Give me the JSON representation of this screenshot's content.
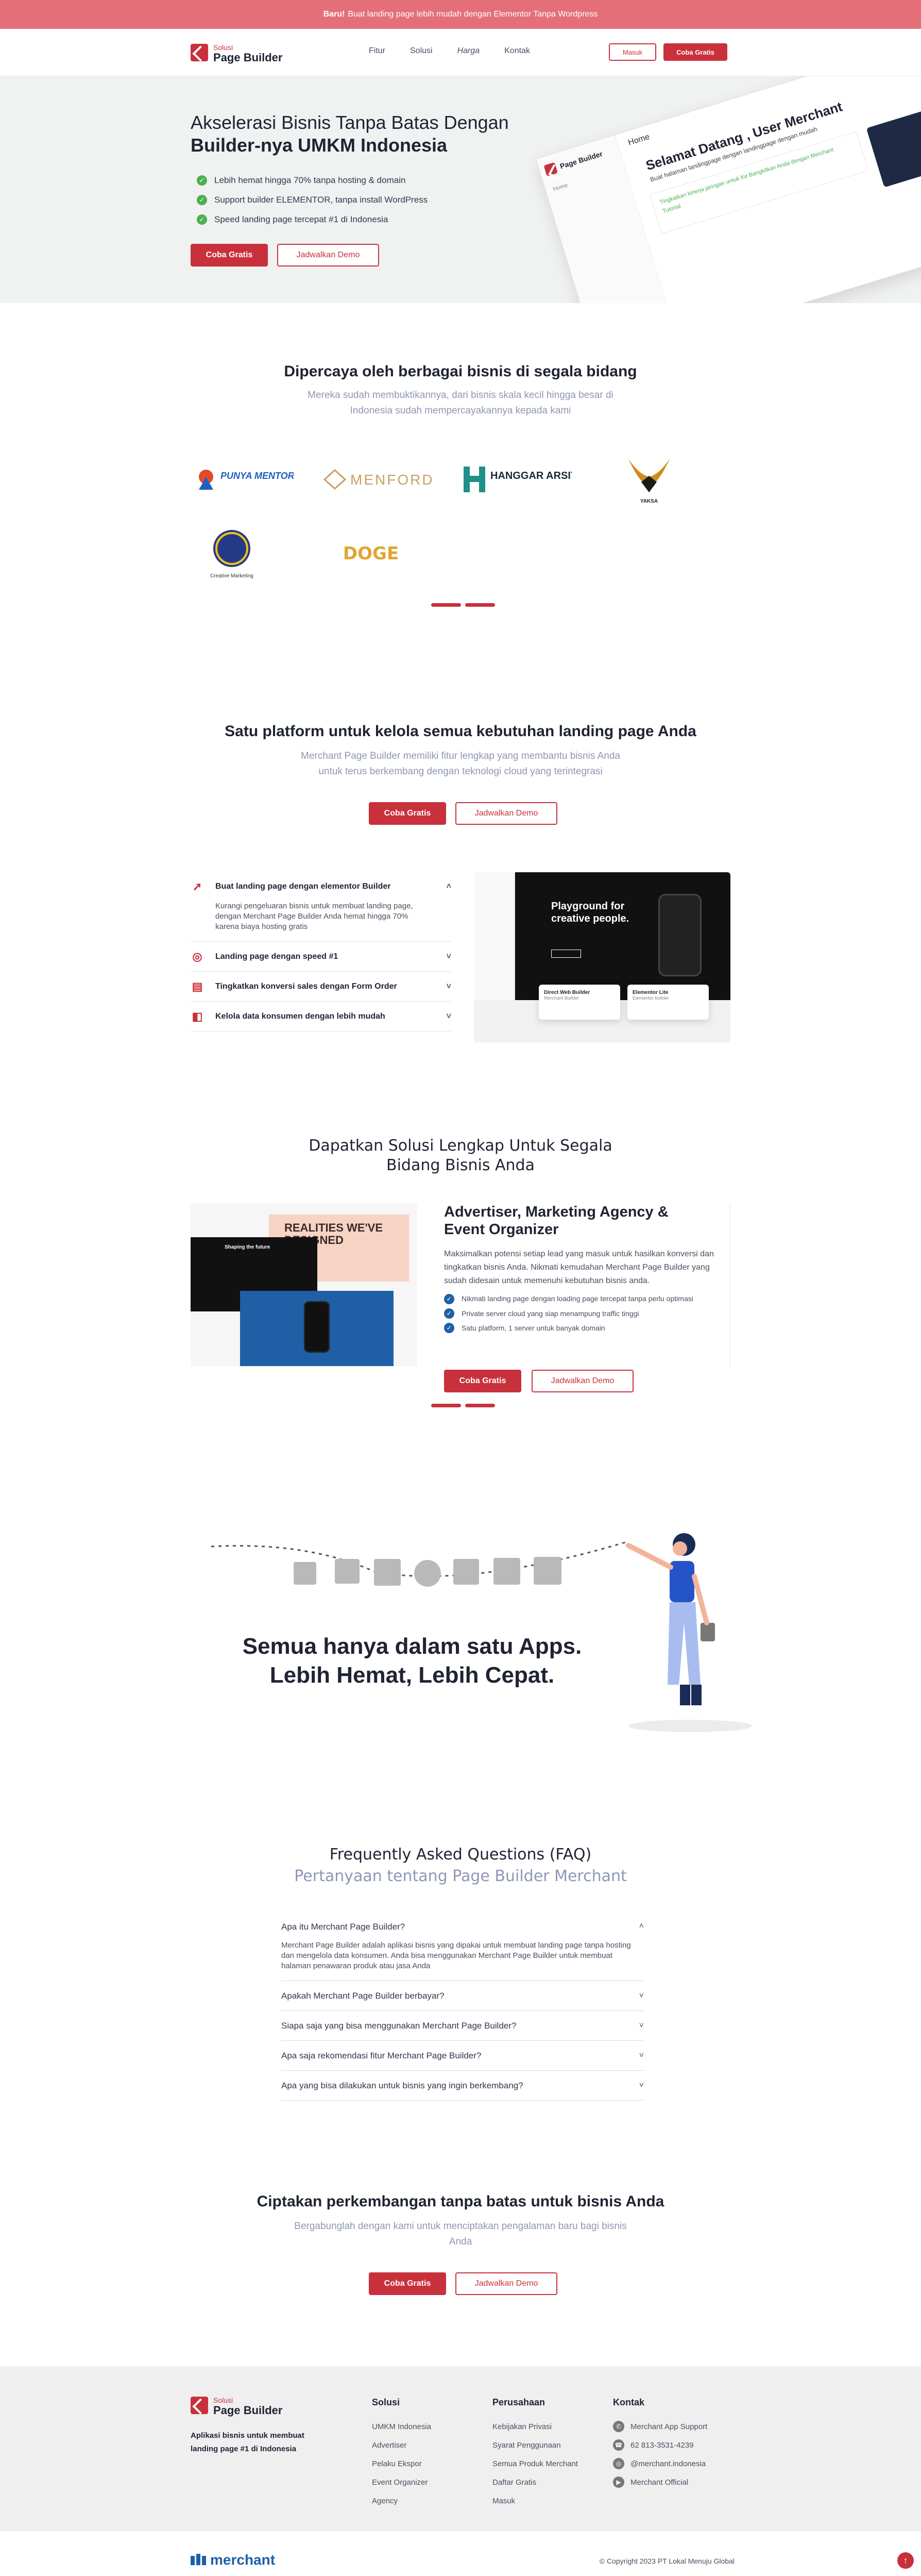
{
  "topbar": {
    "bold": "Baru!",
    "text": "Buat landing page lebih mudah dengan Elementor Tanpa Wordpress"
  },
  "header": {
    "logo_small": "Solusi",
    "logo_big": "Page Builder",
    "nav": [
      "Fitur",
      "Solusi",
      "Harga",
      "Kontak"
    ],
    "login": "Masuk",
    "try": "Coba Gratis"
  },
  "hero": {
    "title_line1": "Akselerasi Bisnis Tanpa Batas Dengan",
    "title_line2": "Builder-nya UMKM Indonesia",
    "bullets": [
      "Lebih hemat hingga 70% tanpa hosting & domain",
      "Support builder ELEMENTOR, tanpa install WordPress",
      "Speed landing page tercepat #1 di Indonesia"
    ],
    "cta_primary": "Coba Gratis",
    "cta_secondary": "Jadwalkan Demo",
    "mock": {
      "brand": "Page Builder",
      "menu_home": "Home",
      "menu_1": "Home",
      "welcome": "Selamat Datang , User Merchant",
      "welcome_sub": "Buat halaman landingpage dengan landingpage dengan mudah",
      "card_text": "Tingkatkan kinerja jaringan untuk Ke Bangkitkan Anda dengan Merchant",
      "card_link": "Tutorial",
      "card_link2": "Tutorial"
    }
  },
  "trusted": {
    "title": "Dipercaya oleh berbagai bisnis di segala bidang",
    "subtitle_l1": "Mereka sudah membuktikannya, dari bisnis skala kecil hingga besar di",
    "subtitle_l2": "Indonesia sudah mempercayakannya kepada kami",
    "logos": [
      {
        "name": "PUNYA MENTOR.COM",
        "color": "#1f5fbf"
      },
      {
        "name": "MENFORD",
        "color": "#c9a062"
      },
      {
        "name": "HANGGAR ARSITEK",
        "color": "#1f8f8a"
      },
      {
        "name": "YAKSA",
        "color": "#d28a1c"
      },
      {
        "name": "Creative Marketing",
        "color": "#243a86"
      },
      {
        "name": "DOGE",
        "color": "#e2a432"
      }
    ]
  },
  "platform": {
    "title": "Satu platform untuk kelola semua kebutuhan landing page Anda",
    "subtitle_l1": "Merchant Page Builder memiliki fitur lengkap yang membantu bisnis Anda",
    "subtitle_l2": "untuk terus berkembang dengan teknologi cloud yang terintegrasi",
    "cta_primary": "Coba Gratis",
    "cta_secondary": "Jadwalkan Demo",
    "features": [
      {
        "icon": "rocket-icon",
        "title": "Buat landing page dengan elementor Builder",
        "desc": "Kurangi pengeluaran bisnis untuk membuat landing page, dengan Merchant Page Builder Anda hemat hingga 70% karena biaya hosting gratis"
      },
      {
        "icon": "speedometer-icon",
        "title": "Landing page dengan speed #1"
      },
      {
        "icon": "form-icon",
        "title": "Tingkatkan konversi sales dengan Form Order"
      },
      {
        "icon": "database-icon",
        "title": "Kelola data konsumen dengan lebih mudah"
      }
    ],
    "preview": {
      "headline_l1": "Playground for",
      "headline_l2": "creative people.",
      "badge1_title": "Direct Web Builder",
      "badge1_sub": "Merchant Builder",
      "badge2_title": "Elementor Lite",
      "badge2_sub": "Elementor builder"
    }
  },
  "solutions": {
    "title_l1": "Dapatkan Solusi Lengkap Untuk Segala",
    "title_l2": "Bidang Bisnis Anda",
    "card_title_l1": "Advertiser, Marketing Agency &",
    "card_title_l2": "Event Organizer",
    "card_desc": "Maksimalkan potensi setiap lead yang masuk untuk hasilkan konversi dan tingkatkan bisnis Anda. Nikmati kemudahan Merchant Page Builder yang sudah didesain untuk memenuhi kebutuhan bisnis anda.",
    "bullets": [
      "Nikmati landing page dengan loading page tercepat tanpa perlu optimasi",
      "Private server cloud yang siap menampung traffic tinggi",
      "Satu platform, 1 server untuk banyak domain"
    ],
    "cta_primary": "Coba Gratis",
    "cta_secondary": "Jadwalkan Demo",
    "mock_headline_l1": "REALITIES WE'VE",
    "mock_headline_l2": "DESIGNED",
    "mock_dark_text": "Shaping the future"
  },
  "apps": {
    "line1": "Semua hanya dalam satu Apps.",
    "line2": "Lebih Hemat, Lebih Cepat."
  },
  "faq": {
    "title": "Frequently Asked Questions (FAQ)",
    "subtitle": "Pertanyaan tentang Page Builder Merchant",
    "items": [
      {
        "q": "Apa itu Merchant Page Builder?",
        "a": "Merchant Page Builder adalah aplikasi bisnis yang dipakai untuk membuat landing page tanpa hosting dan mengelola data konsumen. Anda bisa menggunakan Merchant Page Builder untuk membuat halaman penawaran produk atau jasa Anda"
      },
      {
        "q": "Apakah Merchant Page Builder berbayar?"
      },
      {
        "q": "Siapa saja yang bisa menggunakan Merchant Page Builder?"
      },
      {
        "q": "Apa saja rekomendasi fitur Merchant Page Builder?"
      },
      {
        "q": "Apa yang bisa dilakukan untuk bisnis yang ingin berkembang?"
      }
    ]
  },
  "cta": {
    "title": "Ciptakan perkembangan tanpa batas untuk bisnis Anda",
    "subtitle_l1": "Bergabunglah dengan kami untuk menciptakan pengalaman baru bagi bisnis",
    "subtitle_l2": "Anda",
    "cta_primary": "Coba Gratis",
    "cta_secondary": "Jadwalkan Demo"
  },
  "footer": {
    "logo_small": "Solusi",
    "logo_big": "Page Builder",
    "tagline_l1": "Aplikasi bisnis untuk membuat",
    "tagline_l2": "landing page #1 di Indonesia",
    "col1_title": "Solusi",
    "col1": [
      "UMKM Indonesia",
      "Advertiser",
      "Pelaku Ekspor",
      "Event Organizer",
      "Agency"
    ],
    "col2_title": "Perusahaan",
    "col2": [
      "Kebijakan Privasi",
      "Syarat Penggunaan",
      "Semua Produk Merchant",
      "Daftar Gratis",
      "Masuk"
    ],
    "col3_title": "Kontak",
    "col3": [
      {
        "icon": "support-icon",
        "text": "Merchant App Support"
      },
      {
        "icon": "phone-icon",
        "text": "62 813-3531-4239"
      },
      {
        "icon": "instagram-icon",
        "text": "@merchant.indonesia"
      },
      {
        "icon": "youtube-icon",
        "text": "Merchant Official"
      }
    ],
    "brand": "merchant",
    "copyright": "© Copyright 2023 PT Lokal Menuju Global"
  }
}
